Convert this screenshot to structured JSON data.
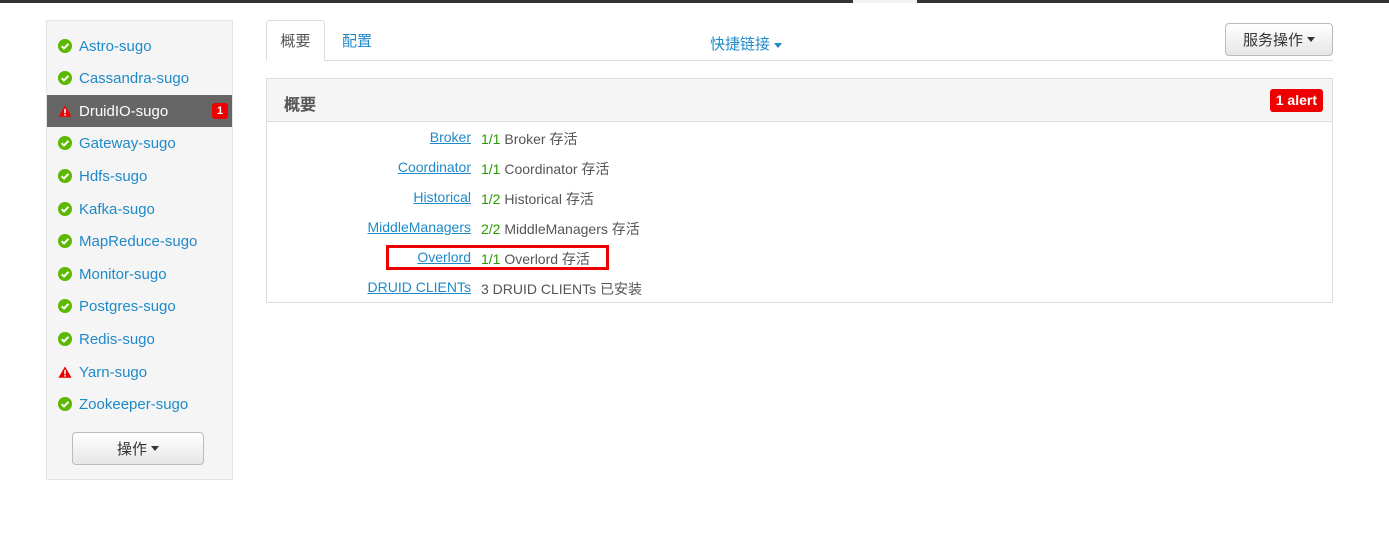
{
  "sidebar": {
    "services": [
      {
        "name": "Astro-sugo",
        "status": "ok",
        "icon": "check-circle-icon"
      },
      {
        "name": "Cassandra-sugo",
        "status": "ok",
        "icon": "check-circle-icon"
      },
      {
        "name": "DruidIO-sugo",
        "status": "alert",
        "icon": "warning-icon",
        "alerts": "1"
      },
      {
        "name": "Gateway-sugo",
        "status": "ok",
        "icon": "check-circle-icon"
      },
      {
        "name": "Hdfs-sugo",
        "status": "ok",
        "icon": "check-circle-icon"
      },
      {
        "name": "Kafka-sugo",
        "status": "ok",
        "icon": "check-circle-icon"
      },
      {
        "name": "MapReduce-sugo",
        "status": "ok",
        "icon": "check-circle-icon"
      },
      {
        "name": "Monitor-sugo",
        "status": "ok",
        "icon": "check-circle-icon"
      },
      {
        "name": "Postgres-sugo",
        "status": "ok",
        "icon": "check-circle-icon"
      },
      {
        "name": "Redis-sugo",
        "status": "ok",
        "icon": "check-circle-icon"
      },
      {
        "name": "Yarn-sugo",
        "status": "alert",
        "icon": "warning-icon"
      },
      {
        "name": "Zookeeper-sugo",
        "status": "ok",
        "icon": "check-circle-icon"
      }
    ],
    "actions_label": "操作"
  },
  "tabs": [
    {
      "label": "概要",
      "active": true
    },
    {
      "label": "配置",
      "active": false
    }
  ],
  "quick_links_label": "快捷链接",
  "service_actions_label": "服务操作",
  "panel": {
    "title": "概要",
    "alert_badge": "1 alert",
    "components": [
      {
        "label": "Broker",
        "count": "1/1",
        "text": "Broker 存活"
      },
      {
        "label": "Coordinator",
        "count": "1/1",
        "text": "Coordinator 存活"
      },
      {
        "label": "Historical",
        "count": "1/2",
        "text": "Historical 存活"
      },
      {
        "label": "MiddleManagers",
        "count": "2/2",
        "text": "MiddleManagers 存活"
      },
      {
        "label": "Overlord",
        "count": "1/1",
        "text": "Overlord 存活",
        "highlighted": true
      },
      {
        "label": "DRUID CLIENTs",
        "count": "",
        "text": "3 DRUID CLIENTs 已安装"
      }
    ]
  },
  "colors": {
    "ok": "#5cb800",
    "alert": "#e00000",
    "link": "#1f8ac9",
    "count": "#2a9b00"
  }
}
